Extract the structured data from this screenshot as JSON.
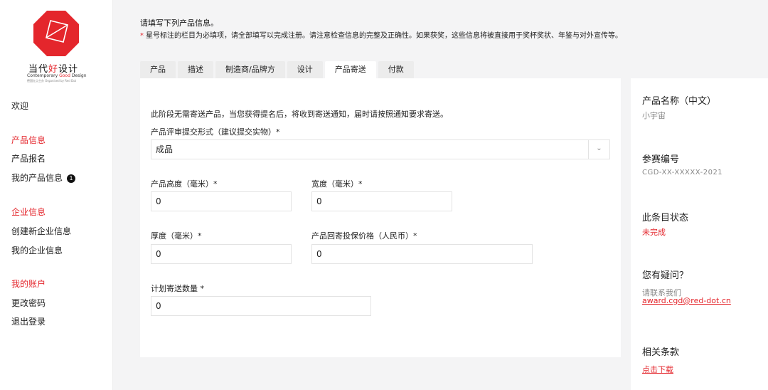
{
  "brand": {
    "name_cn_1": "当代",
    "name_cn_hl": "好",
    "name_cn_2": "设计",
    "name_en_1": "Contemporary ",
    "name_en_hl": "Good",
    "name_en_2": " Design",
    "org": "德国红点主办 Organised by Red Dot",
    "accent": "#e4262c"
  },
  "sidebar": {
    "welcome": "欢迎",
    "product_section": "产品信息",
    "product_signup": "产品报名",
    "my_products": "我的产品信息",
    "my_products_badge": "1",
    "company_section": "企业信息",
    "create_company": "创建新企业信息",
    "my_company": "我的企业信息",
    "account_section": "我的账户",
    "change_password": "更改密码",
    "logout": "退出登录"
  },
  "notice": {
    "title": "请填写下列产品信息。",
    "star": "*",
    "text": "星号标注的栏目为必填项，请全部填写以完成注册。请注意检查信息的完整及正确性。如果获奖，这些信息将被直接用于奖杯奖状、年鉴与对外宣传等。"
  },
  "tabs": [
    {
      "label": "产品"
    },
    {
      "label": "描述"
    },
    {
      "label": "制造商/品牌方"
    },
    {
      "label": "设计"
    },
    {
      "label": "产品寄送"
    },
    {
      "label": "付款"
    }
  ],
  "form": {
    "intro": "此阶段无需寄送产品，当您获得提名后，将收到寄送通知，届时请按照通知要求寄送。",
    "submit_form_label": "产品评审提交形式（建议提交实物）*",
    "submit_form_value": "成品",
    "height_label": "产品高度（毫米）*",
    "height_value": "0",
    "width_label": "宽度（毫米）*",
    "width_value": "0",
    "thickness_label": "厚度（毫米）*",
    "thickness_value": "0",
    "insured_label": "产品回寄投保价格（人民币）*",
    "insured_value": "0",
    "quantity_label": "计划寄送数量 *",
    "quantity_value": "0"
  },
  "info": {
    "product_name_label": "产品名称（中文）",
    "product_name_value": "小宇宙",
    "ref_label": "参赛编号",
    "ref_value": "CGD-XX-XXXXX-2021",
    "status_label": "此条目状态",
    "status_value": "未完成",
    "question_label": "您有疑问？",
    "contact_text": "请联系我们",
    "contact_email": "award.cgd@red-dot.cn",
    "terms_label": "相关条款",
    "terms_link": "点击下载"
  }
}
